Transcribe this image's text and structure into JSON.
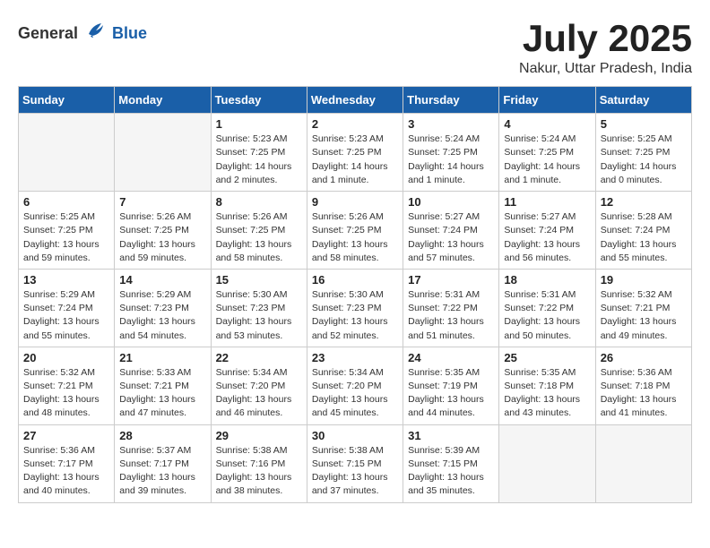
{
  "header": {
    "logo_general": "General",
    "logo_blue": "Blue",
    "month": "July 2025",
    "location": "Nakur, Uttar Pradesh, India"
  },
  "days_of_week": [
    "Sunday",
    "Monday",
    "Tuesday",
    "Wednesday",
    "Thursday",
    "Friday",
    "Saturday"
  ],
  "weeks": [
    [
      {
        "day": null
      },
      {
        "day": null
      },
      {
        "day": 1,
        "sunrise": "Sunrise: 5:23 AM",
        "sunset": "Sunset: 7:25 PM",
        "daylight": "Daylight: 14 hours and 2 minutes."
      },
      {
        "day": 2,
        "sunrise": "Sunrise: 5:23 AM",
        "sunset": "Sunset: 7:25 PM",
        "daylight": "Daylight: 14 hours and 1 minute."
      },
      {
        "day": 3,
        "sunrise": "Sunrise: 5:24 AM",
        "sunset": "Sunset: 7:25 PM",
        "daylight": "Daylight: 14 hours and 1 minute."
      },
      {
        "day": 4,
        "sunrise": "Sunrise: 5:24 AM",
        "sunset": "Sunset: 7:25 PM",
        "daylight": "Daylight: 14 hours and 1 minute."
      },
      {
        "day": 5,
        "sunrise": "Sunrise: 5:25 AM",
        "sunset": "Sunset: 7:25 PM",
        "daylight": "Daylight: 14 hours and 0 minutes."
      }
    ],
    [
      {
        "day": 6,
        "sunrise": "Sunrise: 5:25 AM",
        "sunset": "Sunset: 7:25 PM",
        "daylight": "Daylight: 13 hours and 59 minutes."
      },
      {
        "day": 7,
        "sunrise": "Sunrise: 5:26 AM",
        "sunset": "Sunset: 7:25 PM",
        "daylight": "Daylight: 13 hours and 59 minutes."
      },
      {
        "day": 8,
        "sunrise": "Sunrise: 5:26 AM",
        "sunset": "Sunset: 7:25 PM",
        "daylight": "Daylight: 13 hours and 58 minutes."
      },
      {
        "day": 9,
        "sunrise": "Sunrise: 5:26 AM",
        "sunset": "Sunset: 7:25 PM",
        "daylight": "Daylight: 13 hours and 58 minutes."
      },
      {
        "day": 10,
        "sunrise": "Sunrise: 5:27 AM",
        "sunset": "Sunset: 7:24 PM",
        "daylight": "Daylight: 13 hours and 57 minutes."
      },
      {
        "day": 11,
        "sunrise": "Sunrise: 5:27 AM",
        "sunset": "Sunset: 7:24 PM",
        "daylight": "Daylight: 13 hours and 56 minutes."
      },
      {
        "day": 12,
        "sunrise": "Sunrise: 5:28 AM",
        "sunset": "Sunset: 7:24 PM",
        "daylight": "Daylight: 13 hours and 55 minutes."
      }
    ],
    [
      {
        "day": 13,
        "sunrise": "Sunrise: 5:29 AM",
        "sunset": "Sunset: 7:24 PM",
        "daylight": "Daylight: 13 hours and 55 minutes."
      },
      {
        "day": 14,
        "sunrise": "Sunrise: 5:29 AM",
        "sunset": "Sunset: 7:23 PM",
        "daylight": "Daylight: 13 hours and 54 minutes."
      },
      {
        "day": 15,
        "sunrise": "Sunrise: 5:30 AM",
        "sunset": "Sunset: 7:23 PM",
        "daylight": "Daylight: 13 hours and 53 minutes."
      },
      {
        "day": 16,
        "sunrise": "Sunrise: 5:30 AM",
        "sunset": "Sunset: 7:23 PM",
        "daylight": "Daylight: 13 hours and 52 minutes."
      },
      {
        "day": 17,
        "sunrise": "Sunrise: 5:31 AM",
        "sunset": "Sunset: 7:22 PM",
        "daylight": "Daylight: 13 hours and 51 minutes."
      },
      {
        "day": 18,
        "sunrise": "Sunrise: 5:31 AM",
        "sunset": "Sunset: 7:22 PM",
        "daylight": "Daylight: 13 hours and 50 minutes."
      },
      {
        "day": 19,
        "sunrise": "Sunrise: 5:32 AM",
        "sunset": "Sunset: 7:21 PM",
        "daylight": "Daylight: 13 hours and 49 minutes."
      }
    ],
    [
      {
        "day": 20,
        "sunrise": "Sunrise: 5:32 AM",
        "sunset": "Sunset: 7:21 PM",
        "daylight": "Daylight: 13 hours and 48 minutes."
      },
      {
        "day": 21,
        "sunrise": "Sunrise: 5:33 AM",
        "sunset": "Sunset: 7:21 PM",
        "daylight": "Daylight: 13 hours and 47 minutes."
      },
      {
        "day": 22,
        "sunrise": "Sunrise: 5:34 AM",
        "sunset": "Sunset: 7:20 PM",
        "daylight": "Daylight: 13 hours and 46 minutes."
      },
      {
        "day": 23,
        "sunrise": "Sunrise: 5:34 AM",
        "sunset": "Sunset: 7:20 PM",
        "daylight": "Daylight: 13 hours and 45 minutes."
      },
      {
        "day": 24,
        "sunrise": "Sunrise: 5:35 AM",
        "sunset": "Sunset: 7:19 PM",
        "daylight": "Daylight: 13 hours and 44 minutes."
      },
      {
        "day": 25,
        "sunrise": "Sunrise: 5:35 AM",
        "sunset": "Sunset: 7:18 PM",
        "daylight": "Daylight: 13 hours and 43 minutes."
      },
      {
        "day": 26,
        "sunrise": "Sunrise: 5:36 AM",
        "sunset": "Sunset: 7:18 PM",
        "daylight": "Daylight: 13 hours and 41 minutes."
      }
    ],
    [
      {
        "day": 27,
        "sunrise": "Sunrise: 5:36 AM",
        "sunset": "Sunset: 7:17 PM",
        "daylight": "Daylight: 13 hours and 40 minutes."
      },
      {
        "day": 28,
        "sunrise": "Sunrise: 5:37 AM",
        "sunset": "Sunset: 7:17 PM",
        "daylight": "Daylight: 13 hours and 39 minutes."
      },
      {
        "day": 29,
        "sunrise": "Sunrise: 5:38 AM",
        "sunset": "Sunset: 7:16 PM",
        "daylight": "Daylight: 13 hours and 38 minutes."
      },
      {
        "day": 30,
        "sunrise": "Sunrise: 5:38 AM",
        "sunset": "Sunset: 7:15 PM",
        "daylight": "Daylight: 13 hours and 37 minutes."
      },
      {
        "day": 31,
        "sunrise": "Sunrise: 5:39 AM",
        "sunset": "Sunset: 7:15 PM",
        "daylight": "Daylight: 13 hours and 35 minutes."
      },
      {
        "day": null
      },
      {
        "day": null
      }
    ]
  ]
}
